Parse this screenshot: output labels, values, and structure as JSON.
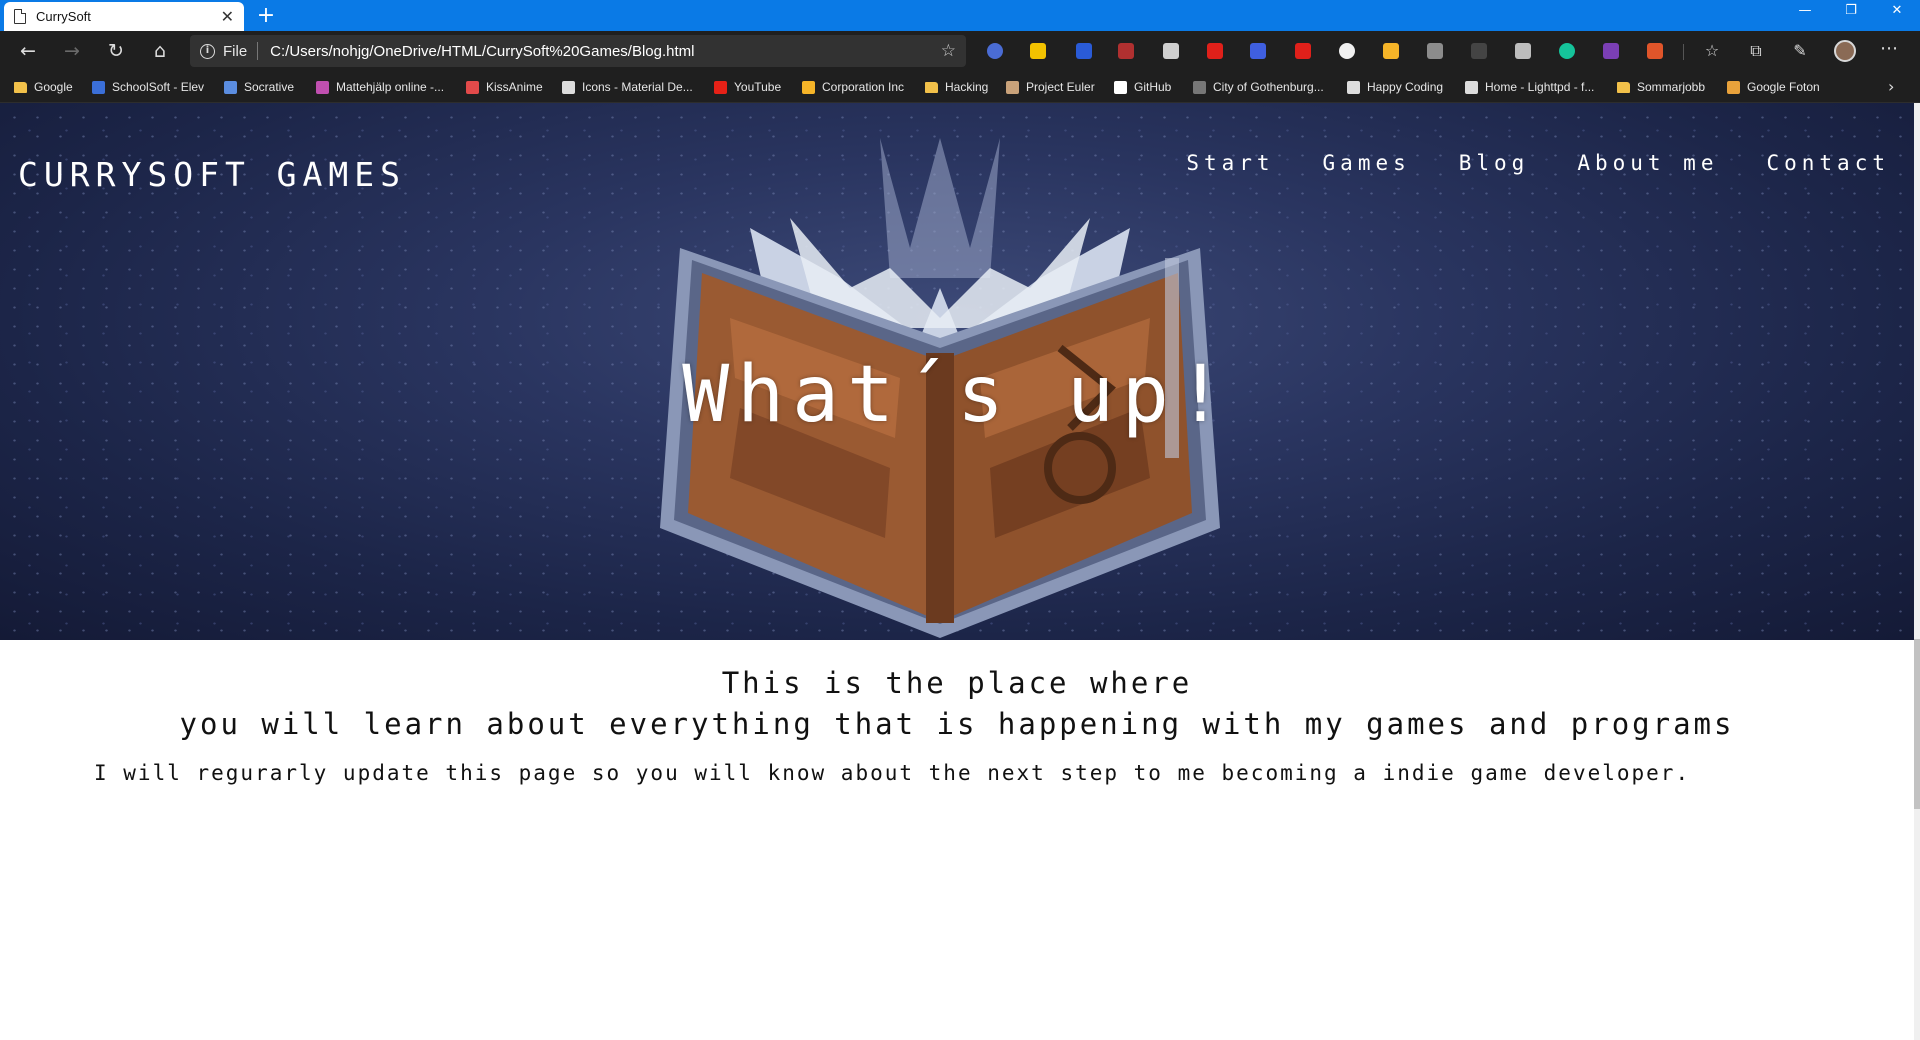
{
  "browser": {
    "tab_title": "CurrySoft",
    "tab_close": "✕",
    "new_tab": "+",
    "window_controls": {
      "minimize": "—",
      "restore": "❐",
      "close": "✕"
    },
    "address": {
      "scheme": "File",
      "url": "C:/Users/nohjg/OneDrive/HTML/CurrySoft%20Games/Blog.html",
      "favorite_star": "☆"
    },
    "favorites": [
      {
        "label": "Google",
        "icon": "folder-icon",
        "color": "#f2c14a"
      },
      {
        "label": "SchoolSoft - Elev",
        "icon": "schoolsoft-icon",
        "color": "#3b6fd8"
      },
      {
        "label": "Socrative",
        "icon": "socrative-icon",
        "color": "#5b8de0"
      },
      {
        "label": "Mattehjälp online -...",
        "icon": "mattehjalp-icon",
        "color": "#c04fb0"
      },
      {
        "label": "KissAnime",
        "icon": "kissanime-icon",
        "color": "#e24a4a"
      },
      {
        "label": "Icons - Material De...",
        "icon": "material-icon",
        "color": "#dddddd"
      },
      {
        "label": "YouTube",
        "icon": "youtube-icon",
        "color": "#e62117"
      },
      {
        "label": "Corporation Inc",
        "icon": "corporation-icon",
        "color": "#f5b428"
      },
      {
        "label": "Hacking",
        "icon": "folder-icon",
        "color": "#f2c14a"
      },
      {
        "label": "Project Euler",
        "icon": "euler-icon",
        "color": "#c9a27a"
      },
      {
        "label": "GitHub",
        "icon": "github-icon",
        "color": "#ffffff"
      },
      {
        "label": "City of Gothenburg...",
        "icon": "gothenburg-icon",
        "color": "#777777"
      },
      {
        "label": "Happy Coding",
        "icon": "page-icon",
        "color": "#dddddd"
      },
      {
        "label": "Home - Lighttpd - f...",
        "icon": "lighttpd-icon",
        "color": "#dddddd"
      },
      {
        "label": "Sommarjobb",
        "icon": "folder-icon",
        "color": "#f2c14a"
      },
      {
        "label": "Google Foton",
        "icon": "google-photos-icon",
        "color": "#e9a23b"
      }
    ],
    "extensions": [
      {
        "name": "ext-circle-icon",
        "color": "#4a6cd4"
      },
      {
        "name": "ext-w-icon",
        "color": "#f2c200"
      },
      {
        "name": "ext-p-icon",
        "color": "#2a5bd7"
      },
      {
        "name": "ext-dash-icon",
        "color": "#b03030"
      },
      {
        "name": "ext-gamepad-icon",
        "color": "#cfcfcf"
      },
      {
        "name": "ext-opera-icon",
        "color": "#e0201a"
      },
      {
        "name": "ext-play-icon",
        "color": "#3f5fe0"
      },
      {
        "name": "ext-pen-icon",
        "color": "#e0201a"
      },
      {
        "name": "ext-white-circle-icon",
        "color": "#f0f0f0"
      },
      {
        "name": "ext-thumb-icon",
        "color": "#f5b428"
      },
      {
        "name": "ext-shield-icon",
        "color": "#8c8c8c"
      },
      {
        "name": "ext-grid-icon",
        "color": "#444444"
      },
      {
        "name": "ext-puzzle-icon",
        "color": "#bdbdbd"
      },
      {
        "name": "ext-grammarly-icon",
        "color": "#15c39a"
      },
      {
        "name": "ext-onenote-icon",
        "color": "#7b3fb5"
      },
      {
        "name": "ext-office-icon",
        "color": "#e0552a"
      }
    ]
  },
  "page": {
    "logo": "CURRYSOFT GAMES",
    "nav": [
      "Start",
      "Games",
      "Blog",
      "About me",
      "Contact"
    ],
    "hero_title": "What´s up!",
    "subtitle_line1": "This is the place where",
    "subtitle_line2": "you will learn about everything that is happening with my games and programs",
    "body_text": "I will regurarly update this page so you will know about the next step to me becoming a indie game developer."
  }
}
